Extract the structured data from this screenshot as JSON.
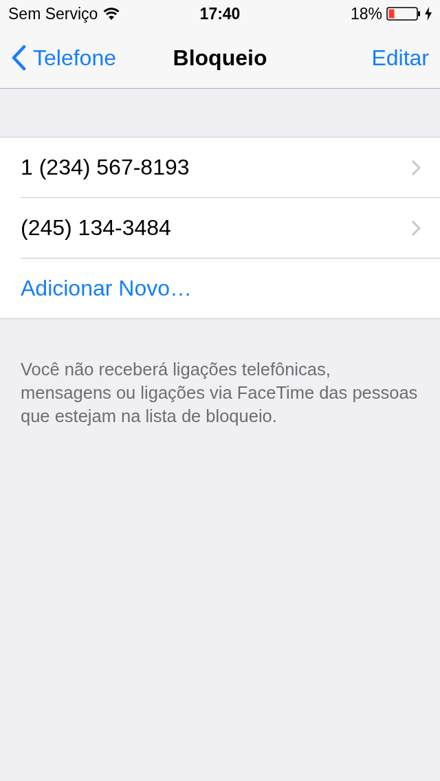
{
  "status_bar": {
    "carrier": "Sem Serviço",
    "time": "17:40",
    "battery": "18%"
  },
  "nav": {
    "back": "Telefone",
    "title": "Bloqueio",
    "action": "Editar"
  },
  "blocked": [
    {
      "kind": "number",
      "label": "1 (234) 567-8193"
    },
    {
      "kind": "number",
      "label": "(245) 134-3484"
    },
    {
      "kind": "add",
      "label": "Adicionar Novo…"
    }
  ],
  "footer": "Você não receberá ligações telefônicas, mensagens ou ligações via FaceTime das pessoas que estejam na lista de bloqueio."
}
